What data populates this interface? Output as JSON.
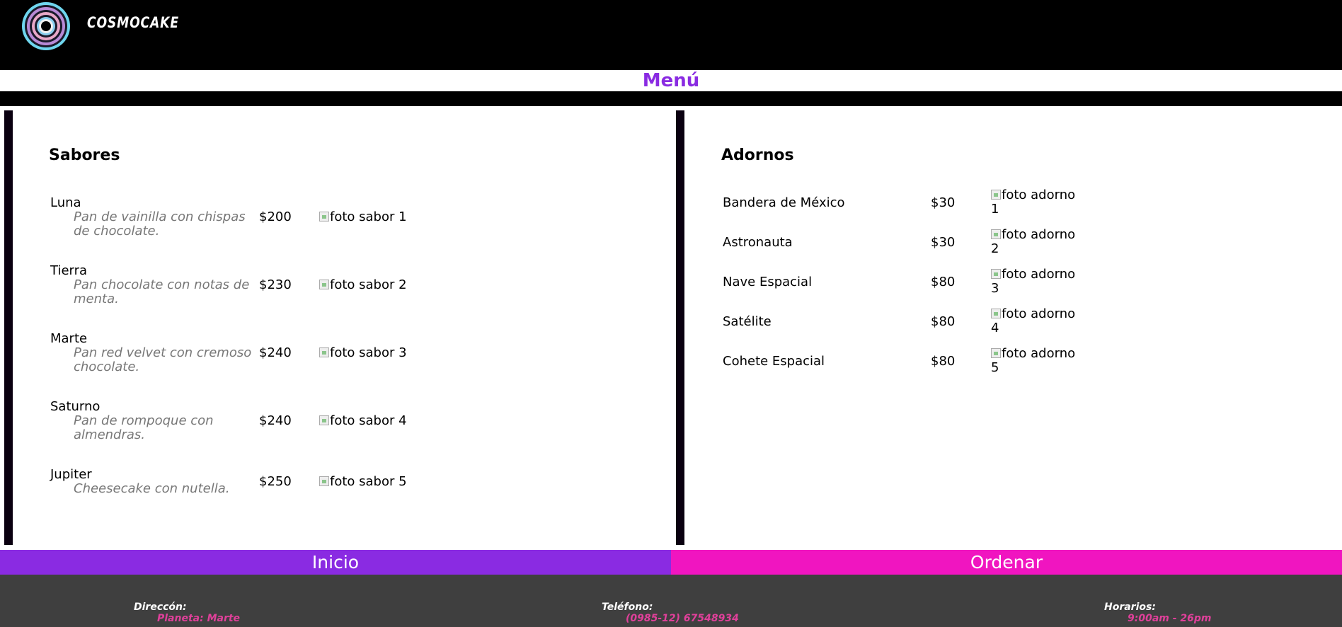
{
  "header": {
    "brand": "COSMOCAKE",
    "logo_icon": "concentric-rings-logo-icon"
  },
  "page_title": "Menú",
  "sabores": {
    "title": "Sabores",
    "items": [
      {
        "name": "Luna",
        "desc": "Pan de vainilla con chispas de chocolate.",
        "price": "$200",
        "photo_alt": "foto sabor 1"
      },
      {
        "name": "Tierra",
        "desc": "Pan chocolate con notas de menta.",
        "price": "$230",
        "photo_alt": "foto sabor 2"
      },
      {
        "name": "Marte",
        "desc": "Pan red velvet con cremoso chocolate.",
        "price": "$240",
        "photo_alt": "foto sabor 3"
      },
      {
        "name": "Saturno",
        "desc": "Pan de rompoque con almendras.",
        "price": "$240",
        "photo_alt": "foto sabor 4"
      },
      {
        "name": "Jupiter",
        "desc": "Cheesecake con nutella.",
        "price": "$250",
        "photo_alt": "foto sabor 5"
      }
    ]
  },
  "adornos": {
    "title": "Adornos",
    "items": [
      {
        "name": "Bandera de México",
        "price": "$30",
        "photo_alt_1": "foto adorno",
        "photo_alt_2": "1"
      },
      {
        "name": "Astronauta",
        "price": "$30",
        "photo_alt_1": "foto adorno",
        "photo_alt_2": "2"
      },
      {
        "name": "Nave Espacial",
        "price": "$80",
        "photo_alt_1": "foto adorno",
        "photo_alt_2": "3"
      },
      {
        "name": "Satélite",
        "price": "$80",
        "photo_alt_1": "foto adorno",
        "photo_alt_2": "4"
      },
      {
        "name": "Cohete Espacial",
        "price": "$80",
        "photo_alt_1": "foto adorno",
        "photo_alt_2": "5"
      }
    ]
  },
  "nav": {
    "inicio": "Inicio",
    "ordenar": "Ordenar"
  },
  "footer": {
    "direccion_label": "Direccón:",
    "direccion_value": "Planeta: Marte",
    "telefono_label": "Teléfono:",
    "telefono_value": "(0985-12) 67548934",
    "horarios_label": "Horarios:",
    "horarios_value": "9:00am - 26pm"
  },
  "colors": {
    "purple": "#8a2be2",
    "pink": "#f015c0",
    "footer_bg": "#3f3f3f",
    "footer_value": "#e0409a"
  }
}
